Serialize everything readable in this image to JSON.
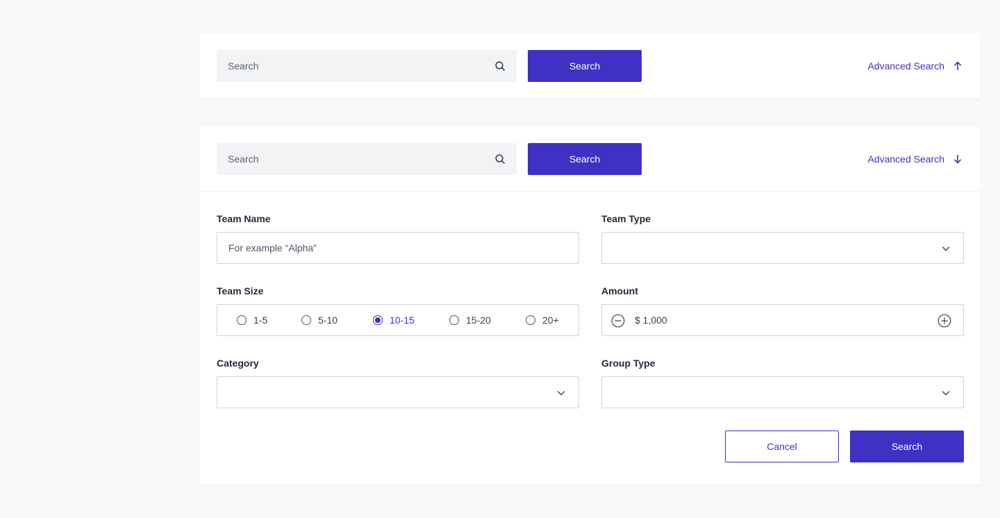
{
  "colors": {
    "primary": "#3f31c4",
    "background": "#f8f9fb",
    "input_bg": "#f2f3f5",
    "border": "#cfd3da"
  },
  "simple_search": {
    "placeholder": "Search",
    "button_label": "Search",
    "advanced_label": "Advanced Search",
    "advanced_icon": "arrow-up-icon"
  },
  "advanced_search": {
    "placeholder": "Search",
    "button_label": "Search",
    "advanced_label": "Advanced Search",
    "advanced_icon": "arrow-down-icon",
    "form": {
      "team_name": {
        "label": "Team Name",
        "placeholder": "For example “Alpha”",
        "value": ""
      },
      "team_type": {
        "label": "Team Type",
        "value": ""
      },
      "team_size": {
        "label": "Team Size",
        "options": [
          "1-5",
          "5-10",
          "10-15",
          "15-20",
          "20+"
        ],
        "selected": "10-15"
      },
      "amount": {
        "label": "Amount",
        "value": "$ 1,000"
      },
      "category": {
        "label": "Category",
        "value": ""
      },
      "group_type": {
        "label": "Group Type",
        "value": ""
      },
      "cancel_label": "Cancel",
      "submit_label": "Search"
    }
  }
}
